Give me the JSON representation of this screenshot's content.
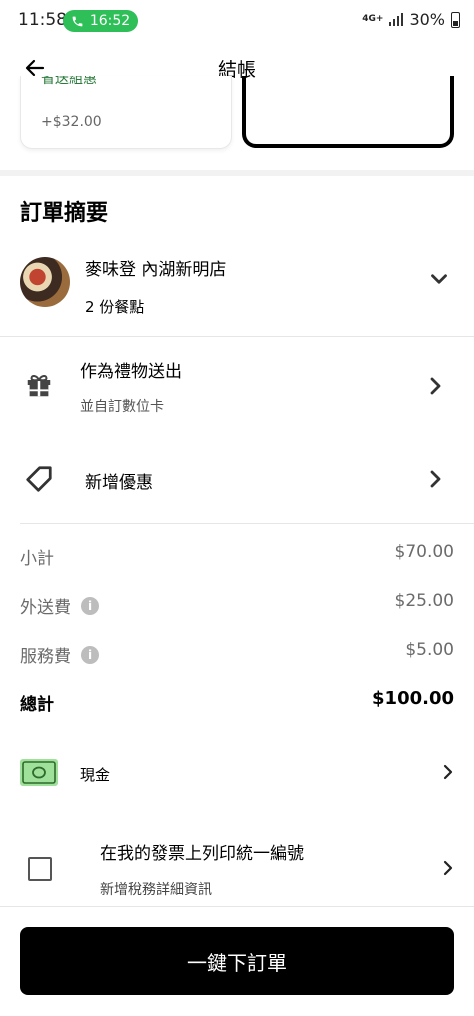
{
  "status_bar": {
    "time": "11:58",
    "call_timer": "16:52",
    "network": "4G+",
    "battery": "30%"
  },
  "header": {
    "title": "結帳"
  },
  "promo_card": {
    "label": "省送組惠",
    "price": "+$32.00"
  },
  "order_summary": {
    "section_title": "訂單摘要",
    "store_name": "麥味登 內湖新明店",
    "item_count": "2 份餐點"
  },
  "gift": {
    "title": "作為禮物送出",
    "subtitle": "並自訂數位卡"
  },
  "promotion": {
    "label": "新增優惠"
  },
  "costs": {
    "subtotal_label": "小計",
    "subtotal": "$70.00",
    "delivery_label": "外送費",
    "delivery": "$25.00",
    "service_label": "服務費",
    "service": "$5.00",
    "total_label": "總計",
    "total": "$100.00"
  },
  "payment": {
    "method": "現金"
  },
  "invoice": {
    "title": "在我的發票上列印統一編號",
    "subtitle": "新增稅務詳細資訊"
  },
  "actions": {
    "place_order": "一鍵下訂單"
  },
  "colors": {
    "accent_green": "#2fbf58",
    "primary": "#000000",
    "muted": "#6b6b6b"
  }
}
